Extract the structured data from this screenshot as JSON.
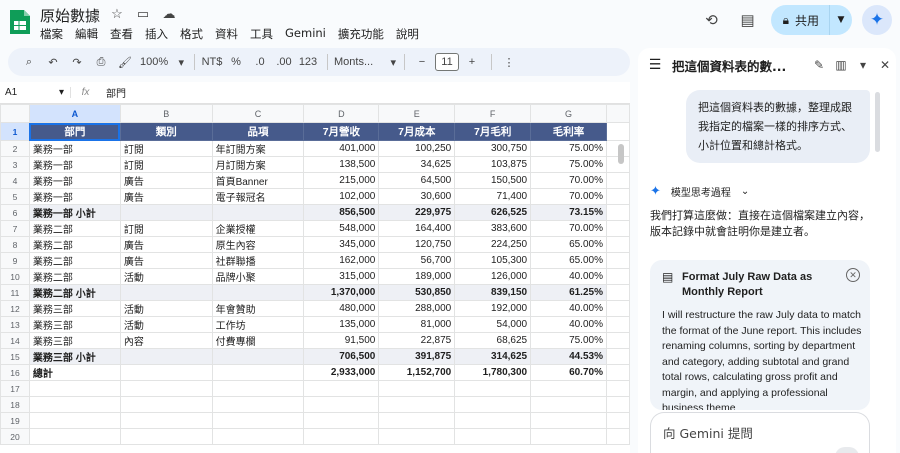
{
  "doc": {
    "title": "原始數據"
  },
  "menu": [
    "檔案",
    "編輯",
    "查看",
    "插入",
    "格式",
    "資料",
    "工具",
    "Gemini",
    "擴充功能",
    "說明"
  ],
  "header": {
    "share_label": "共用"
  },
  "toolbar": {
    "zoom": "100%",
    "currency": "NT$",
    "percent": "%",
    "dec_less": ".0",
    "dec_more": ".00",
    "number_format": "123",
    "font": "Monts...",
    "font_size": "11"
  },
  "formula": {
    "cell": "A1",
    "fx": "fx",
    "value": "部門"
  },
  "grid": {
    "columns": [
      "A",
      "B",
      "C",
      "D",
      "E",
      "F",
      "G"
    ],
    "header": [
      "部門",
      "類別",
      "品項",
      "7月營收",
      "7月成本",
      "7月毛利",
      "毛利率"
    ],
    "rows": [
      {
        "n": "2",
        "type": "data",
        "cells": [
          "業務一部",
          "訂閱",
          "年訂閱方案",
          "401,000",
          "100,250",
          "300,750",
          "75.00%"
        ]
      },
      {
        "n": "3",
        "type": "data",
        "cells": [
          "業務一部",
          "訂閱",
          "月訂閱方案",
          "138,500",
          "34,625",
          "103,875",
          "75.00%"
        ]
      },
      {
        "n": "4",
        "type": "data",
        "cells": [
          "業務一部",
          "廣告",
          "首頁Banner",
          "215,000",
          "64,500",
          "150,500",
          "70.00%"
        ]
      },
      {
        "n": "5",
        "type": "data",
        "cells": [
          "業務一部",
          "廣告",
          "電子報冠名",
          "102,000",
          "30,600",
          "71,400",
          "70.00%"
        ]
      },
      {
        "n": "6",
        "type": "sub",
        "cells": [
          "業務一部 小計",
          "",
          "",
          "856,500",
          "229,975",
          "626,525",
          "73.15%"
        ]
      },
      {
        "n": "7",
        "type": "data",
        "cells": [
          "業務二部",
          "訂閱",
          "企業授權",
          "548,000",
          "164,400",
          "383,600",
          "70.00%"
        ]
      },
      {
        "n": "8",
        "type": "data",
        "cells": [
          "業務二部",
          "廣告",
          "原生內容",
          "345,000",
          "120,750",
          "224,250",
          "65.00%"
        ]
      },
      {
        "n": "9",
        "type": "data",
        "cells": [
          "業務二部",
          "廣告",
          "社群聯播",
          "162,000",
          "56,700",
          "105,300",
          "65.00%"
        ]
      },
      {
        "n": "10",
        "type": "data",
        "cells": [
          "業務二部",
          "活動",
          "品牌小聚",
          "315,000",
          "189,000",
          "126,000",
          "40.00%"
        ]
      },
      {
        "n": "11",
        "type": "sub",
        "cells": [
          "業務二部 小計",
          "",
          "",
          "1,370,000",
          "530,850",
          "839,150",
          "61.25%"
        ]
      },
      {
        "n": "12",
        "type": "data",
        "cells": [
          "業務三部",
          "活動",
          "年會贊助",
          "480,000",
          "288,000",
          "192,000",
          "40.00%"
        ]
      },
      {
        "n": "13",
        "type": "data",
        "cells": [
          "業務三部",
          "活動",
          "工作坊",
          "135,000",
          "81,000",
          "54,000",
          "40.00%"
        ]
      },
      {
        "n": "14",
        "type": "data",
        "cells": [
          "業務三部",
          "內容",
          "付費專欄",
          "91,500",
          "22,875",
          "68,625",
          "75.00%"
        ]
      },
      {
        "n": "15",
        "type": "sub",
        "cells": [
          "業務三部 小計",
          "",
          "",
          "706,500",
          "391,875",
          "314,625",
          "44.53%"
        ]
      },
      {
        "n": "16",
        "type": "tot",
        "cells": [
          "總計",
          "",
          "",
          "2,933,000",
          "1,152,700",
          "1,780,300",
          "60.70%"
        ]
      },
      {
        "n": "17",
        "type": "empty",
        "cells": [
          "",
          "",
          "",
          "",
          "",
          "",
          ""
        ]
      },
      {
        "n": "18",
        "type": "empty",
        "cells": [
          "",
          "",
          "",
          "",
          "",
          "",
          ""
        ]
      },
      {
        "n": "19",
        "type": "empty",
        "cells": [
          "",
          "",
          "",
          "",
          "",
          "",
          ""
        ]
      },
      {
        "n": "20",
        "type": "empty",
        "cells": [
          "",
          "",
          "",
          "",
          "",
          "",
          ""
        ]
      }
    ]
  },
  "panel": {
    "title": "把這個資料表的數...",
    "user_message": "把這個資料表的數據，整理成跟我指定的檔案一樣的排序方式、小計位置和總計格式。",
    "thinking_label": "模型思考過程",
    "reply": "我們打算這麼做：直接在這個檔案建立內容，版本記錄中就會註明你是建立者。",
    "card_title": "Format July Raw Data as Monthly Report",
    "card_body": "I will restructure the raw July data to match the format of the June report. This includes renaming columns, sorting by department and category, adding subtotal and grand total rows, calculating gross profit and margin, and applying a professional business theme",
    "prompt_placeholder": "向 Gemini 提問"
  },
  "colors": {
    "header_fill": "#465a8b",
    "accent": "#1a73e8",
    "share_bg": "#c2e7ff"
  }
}
